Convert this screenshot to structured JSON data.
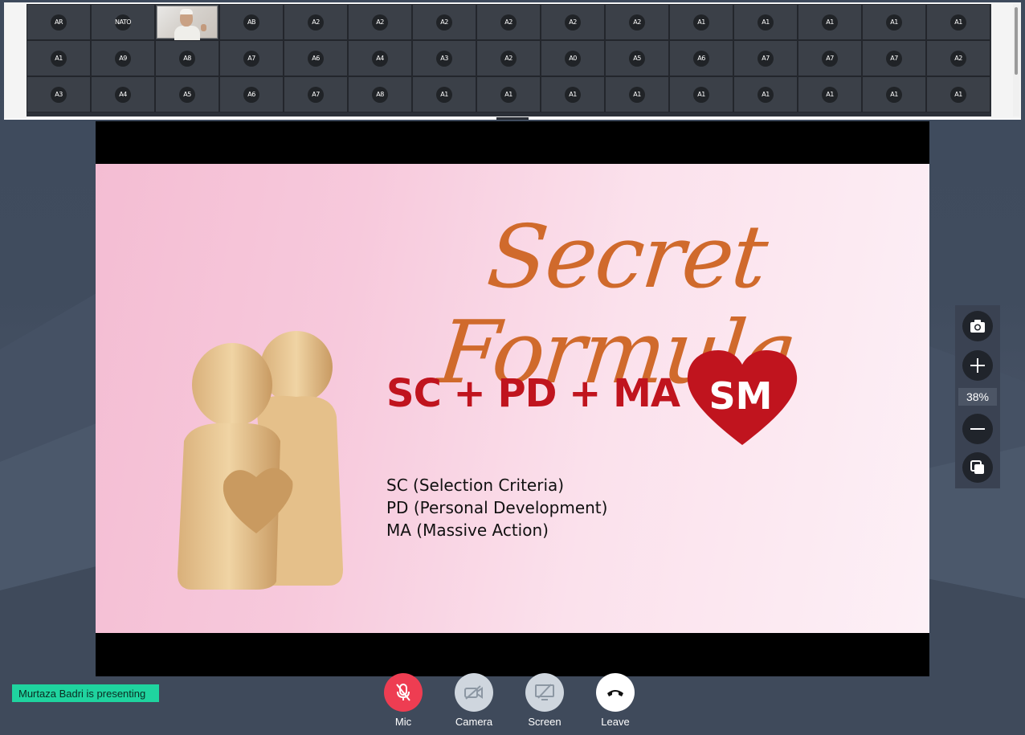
{
  "participants": {
    "rows": [
      [
        "AR",
        "NATO",
        "",
        "AB",
        "A2",
        "A2",
        "A2",
        "A2",
        "A2",
        "A2",
        "A1",
        "A1",
        "A1",
        "A1",
        "A1"
      ],
      [
        "A1",
        "A9",
        "A8",
        "A7",
        "A6",
        "A4",
        "A3",
        "A2",
        "A0",
        "A5",
        "A6",
        "A7",
        "A7",
        "A7",
        "A2"
      ],
      [
        "A3",
        "A4",
        "A5",
        "A6",
        "A7",
        "A8",
        "A1",
        "A1",
        "A1",
        "A1",
        "A1",
        "A1",
        "A1",
        "A1",
        "A1"
      ]
    ]
  },
  "slide": {
    "title": "Secret Formula",
    "formula": "SC + PD + MA",
    "equals": "=",
    "result": "SM",
    "definitions": [
      "SC (Selection Criteria)",
      "PD (Personal Development)",
      "MA (Massive Action)"
    ]
  },
  "zoom": {
    "level": "38%"
  },
  "status": {
    "presenting": "Murtaza Badri is presenting"
  },
  "controls": {
    "mic": "Mic",
    "camera": "Camera",
    "screen": "Screen",
    "leave": "Leave"
  },
  "colors": {
    "title_orange": "#d06a2c",
    "formula_red": "#c0141e",
    "mic_red": "#ee3d52",
    "presenting_green": "#1fd49f"
  }
}
